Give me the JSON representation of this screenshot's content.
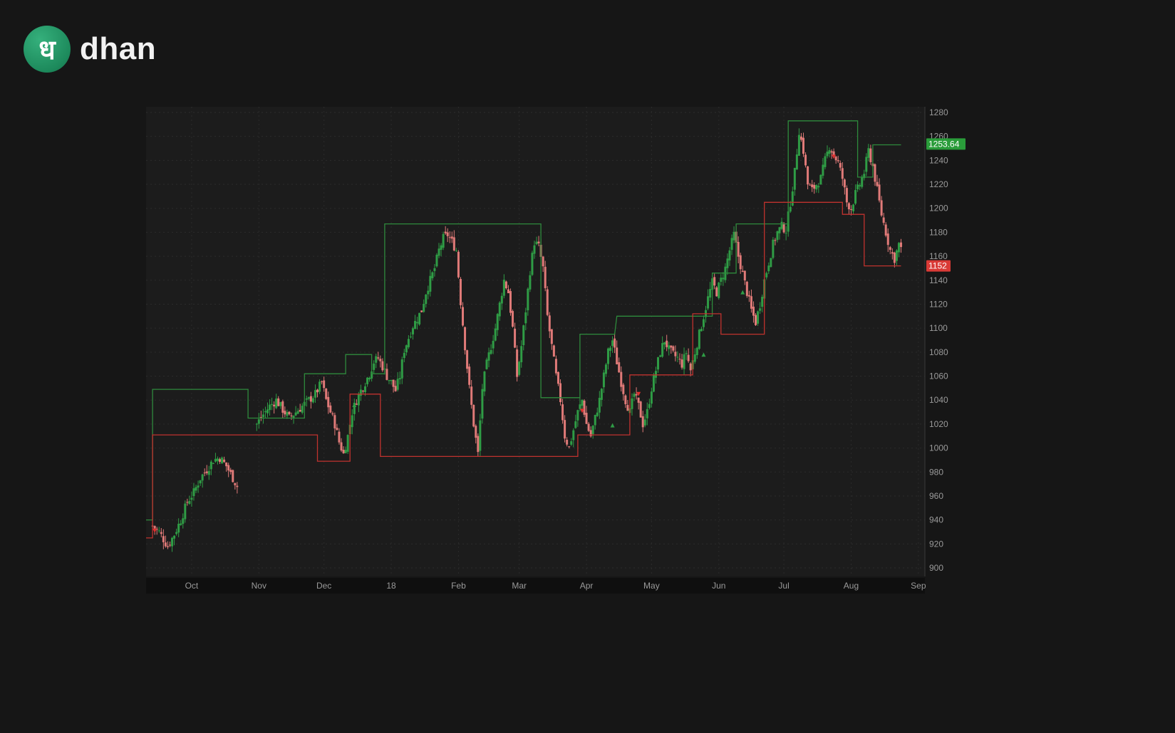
{
  "brand": {
    "logo_glyph": "ध",
    "name": "dhan",
    "accent": "#1f9463"
  },
  "chart_data": {
    "type": "candlestick",
    "colors": {
      "up": "#2f9c45",
      "down": "#e07a78",
      "upper_band": "#2e8a3c",
      "lower_band": "#c0322e",
      "background": "#1c1c1c"
    },
    "ylim": [
      900,
      1280
    ],
    "y_ticks": [
      1280,
      1260,
      1240,
      1220,
      1200,
      1180,
      1160,
      1140,
      1120,
      1100,
      1080,
      1060,
      1040,
      1020,
      1000,
      980,
      960,
      940,
      920,
      900
    ],
    "x_ticks": [
      {
        "label": "Oct",
        "day": 46
      },
      {
        "label": "Nov",
        "day": 77
      },
      {
        "label": "Dec",
        "day": 107
      },
      {
        "label": "18",
        "day": 138
      },
      {
        "label": "Feb",
        "day": 169
      },
      {
        "label": "Mar",
        "day": 197
      },
      {
        "label": "Apr",
        "day": 228
      },
      {
        "label": "May",
        "day": 258
      },
      {
        "label": "Jun",
        "day": 289
      },
      {
        "label": "Jul",
        "day": 319
      },
      {
        "label": "Aug",
        "day": 350
      },
      {
        "label": "Sep",
        "day": 381
      }
    ],
    "x_range": [
      25,
      384
    ],
    "last_price": {
      "label": "1253.64",
      "value": 1253.64,
      "color": "#2a9c3a"
    },
    "lower_value": {
      "label": "1152",
      "value": 1152,
      "color": "#d93a36"
    },
    "close_path": [
      [
        28,
        935
      ],
      [
        31,
        930
      ],
      [
        35,
        918
      ],
      [
        38,
        928
      ],
      [
        41,
        940
      ],
      [
        44,
        955
      ],
      [
        47,
        963
      ],
      [
        50,
        975
      ],
      [
        53,
        982
      ],
      [
        56,
        990
      ],
      [
        59,
        992
      ],
      [
        62,
        985
      ],
      [
        65,
        975
      ],
      [
        67,
        968
      ],
      [
        76,
        1020
      ],
      [
        79,
        1028
      ],
      [
        82,
        1035
      ],
      [
        85,
        1040
      ],
      [
        88,
        1032
      ],
      [
        91,
        1025
      ],
      [
        94,
        1030
      ],
      [
        97,
        1035
      ],
      [
        100,
        1040
      ],
      [
        103,
        1045
      ],
      [
        106,
        1055
      ],
      [
        108,
        1040
      ],
      [
        110,
        1030
      ],
      [
        112,
        1020
      ],
      [
        114,
        1005
      ],
      [
        116,
        995
      ],
      [
        118,
        1010
      ],
      [
        120,
        1030
      ],
      [
        122,
        1040
      ],
      [
        124,
        1048
      ],
      [
        126,
        1055
      ],
      [
        128,
        1062
      ],
      [
        130,
        1072
      ],
      [
        132,
        1075
      ],
      [
        134,
        1068
      ],
      [
        136,
        1060
      ],
      [
        138,
        1055
      ],
      [
        140,
        1048
      ],
      [
        142,
        1060
      ],
      [
        144,
        1082
      ],
      [
        146,
        1092
      ],
      [
        148,
        1102
      ],
      [
        150,
        1108
      ],
      [
        152,
        1115
      ],
      [
        154,
        1130
      ],
      [
        156,
        1140
      ],
      [
        158,
        1150
      ],
      [
        160,
        1165
      ],
      [
        162,
        1175
      ],
      [
        164,
        1178
      ],
      [
        166,
        1172
      ],
      [
        168,
        1165
      ],
      [
        170,
        1122
      ],
      [
        172,
        1085
      ],
      [
        174,
        1050
      ],
      [
        176,
        1020
      ],
      [
        178,
        995
      ],
      [
        180,
        1050
      ],
      [
        182,
        1070
      ],
      [
        184,
        1085
      ],
      [
        186,
        1100
      ],
      [
        188,
        1120
      ],
      [
        190,
        1140
      ],
      [
        192,
        1130
      ],
      [
        194,
        1100
      ],
      [
        196,
        1060
      ],
      [
        198,
        1085
      ],
      [
        200,
        1115
      ],
      [
        202,
        1148
      ],
      [
        204,
        1172
      ],
      [
        206,
        1168
      ],
      [
        208,
        1150
      ],
      [
        210,
        1110
      ],
      [
        212,
        1085
      ],
      [
        214,
        1060
      ],
      [
        216,
        1040
      ],
      [
        218,
        1010
      ],
      [
        220,
        1000
      ],
      [
        222,
        1015
      ],
      [
        224,
        1030
      ],
      [
        226,
        1040
      ],
      [
        228,
        1020
      ],
      [
        230,
        1010
      ],
      [
        232,
        1025
      ],
      [
        234,
        1040
      ],
      [
        236,
        1060
      ],
      [
        238,
        1080
      ],
      [
        240,
        1090
      ],
      [
        242,
        1072
      ],
      [
        244,
        1055
      ],
      [
        246,
        1040
      ],
      [
        248,
        1030
      ],
      [
        250,
        1045
      ],
      [
        252,
        1035
      ],
      [
        254,
        1020
      ],
      [
        256,
        1030
      ],
      [
        258,
        1050
      ],
      [
        260,
        1065
      ],
      [
        262,
        1080
      ],
      [
        264,
        1090
      ],
      [
        266,
        1082
      ],
      [
        268,
        1078
      ],
      [
        270,
        1075
      ],
      [
        272,
        1070
      ],
      [
        274,
        1080
      ],
      [
        276,
        1065
      ],
      [
        278,
        1080
      ],
      [
        280,
        1095
      ],
      [
        282,
        1110
      ],
      [
        284,
        1125
      ],
      [
        286,
        1138
      ],
      [
        288,
        1130
      ],
      [
        290,
        1140
      ],
      [
        292,
        1150
      ],
      [
        294,
        1165
      ],
      [
        296,
        1178
      ],
      [
        298,
        1160
      ],
      [
        300,
        1145
      ],
      [
        302,
        1130
      ],
      [
        304,
        1115
      ],
      [
        306,
        1105
      ],
      [
        308,
        1120
      ],
      [
        310,
        1140
      ],
      [
        312,
        1155
      ],
      [
        314,
        1170
      ],
      [
        316,
        1180
      ],
      [
        318,
        1185
      ],
      [
        320,
        1182
      ],
      [
        322,
        1205
      ],
      [
        324,
        1230
      ],
      [
        326,
        1265
      ],
      [
        328,
        1248
      ],
      [
        330,
        1220
      ],
      [
        332,
        1215
      ],
      [
        334,
        1220
      ],
      [
        336,
        1225
      ],
      [
        338,
        1240
      ],
      [
        340,
        1252
      ],
      [
        342,
        1245
      ],
      [
        344,
        1238
      ],
      [
        346,
        1225
      ],
      [
        348,
        1205
      ],
      [
        350,
        1200
      ],
      [
        352,
        1212
      ],
      [
        354,
        1220
      ],
      [
        356,
        1230
      ],
      [
        358,
        1248
      ],
      [
        360,
        1235
      ],
      [
        362,
        1215
      ],
      [
        364,
        1195
      ],
      [
        366,
        1180
      ],
      [
        368,
        1165
      ],
      [
        370,
        1158
      ],
      [
        372,
        1170
      ],
      [
        373,
        1165
      ]
    ],
    "upper_band": [
      [
        25,
        940
      ],
      [
        28,
        940
      ],
      [
        28,
        1049
      ],
      [
        69,
        1049
      ],
      [
        69,
        1049
      ],
      [
        72,
        1049
      ],
      [
        72,
        1025
      ],
      [
        98,
        1025
      ],
      [
        98,
        1062
      ],
      [
        117,
        1062
      ],
      [
        117,
        1078
      ],
      [
        129,
        1078
      ],
      [
        129,
        1062
      ],
      [
        135,
        1062
      ],
      [
        135,
        1187
      ],
      [
        204,
        1187
      ],
      [
        204,
        1187
      ],
      [
        207,
        1187
      ],
      [
        207,
        1042
      ],
      [
        225,
        1042
      ],
      [
        225,
        1095
      ],
      [
        241,
        1095
      ],
      [
        241,
        1095
      ],
      [
        242,
        1110
      ],
      [
        286,
        1110
      ],
      [
        286,
        1146
      ],
      [
        297,
        1146
      ],
      [
        297,
        1187
      ],
      [
        313,
        1187
      ],
      [
        313,
        1187
      ],
      [
        321,
        1187
      ],
      [
        321,
        1273
      ],
      [
        353,
        1273
      ],
      [
        353,
        1226
      ],
      [
        360,
        1226
      ],
      [
        360,
        1253
      ],
      [
        373,
        1253
      ]
    ],
    "lower_band": [
      [
        25,
        925
      ],
      [
        28,
        925
      ],
      [
        28,
        1011
      ],
      [
        104,
        1011
      ],
      [
        104,
        989
      ],
      [
        119,
        989
      ],
      [
        119,
        1045
      ],
      [
        133,
        1045
      ],
      [
        133,
        993
      ],
      [
        224,
        993
      ],
      [
        224,
        1011
      ],
      [
        241,
        1011
      ],
      [
        241,
        1011
      ],
      [
        248,
        1011
      ],
      [
        248,
        1061
      ],
      [
        277,
        1061
      ],
      [
        277,
        1112
      ],
      [
        287,
        1112
      ],
      [
        287,
        1112
      ],
      [
        290,
        1112
      ],
      [
        290,
        1095
      ],
      [
        310,
        1095
      ],
      [
        310,
        1205
      ],
      [
        346,
        1205
      ],
      [
        346,
        1195
      ],
      [
        356,
        1195
      ],
      [
        356,
        1152
      ],
      [
        373,
        1152
      ]
    ],
    "markers": [
      {
        "type": "arrow-down",
        "day": 29,
        "value": 931,
        "color": "#e03030"
      },
      {
        "type": "arrow-up",
        "day": 121,
        "value": 1036,
        "color": "#2f9c45"
      },
      {
        "type": "arrow-down",
        "day": 226,
        "value": 1031,
        "color": "#e03030"
      },
      {
        "type": "arrow-up",
        "day": 240,
        "value": 1019,
        "color": "#2f9c45"
      },
      {
        "type": "arrow-down",
        "day": 252,
        "value": 1045,
        "color": "#e03030"
      },
      {
        "type": "arrow-up",
        "day": 282,
        "value": 1078,
        "color": "#2f9c45"
      },
      {
        "type": "arrow-up",
        "day": 300,
        "value": 1130,
        "color": "#2f9c45"
      },
      {
        "type": "arrow-down",
        "day": 342,
        "value": 1243,
        "color": "#e03030"
      }
    ]
  }
}
